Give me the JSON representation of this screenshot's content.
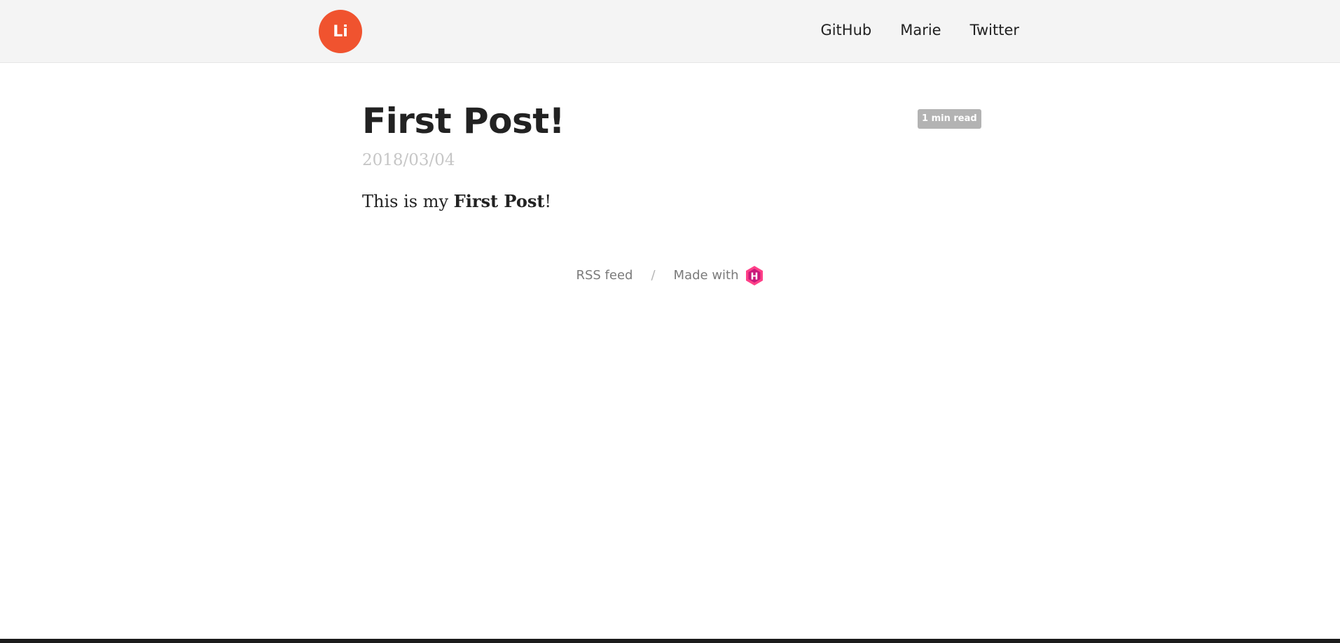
{
  "header": {
    "logo_text": "Li",
    "nav": [
      {
        "label": "GitHub"
      },
      {
        "label": "Marie"
      },
      {
        "label": "Twitter"
      }
    ]
  },
  "post": {
    "title": "First Post!",
    "read_time": "1 min read",
    "date": "2018/03/04",
    "body_prefix": "This is my ",
    "body_bold": "First Post",
    "body_suffix": "!"
  },
  "footer": {
    "rss_label": "RSS feed",
    "separator": "/",
    "made_with": "Made with",
    "hugo_icon": "hugo-icon",
    "hugo_color": "#ff4088"
  },
  "colors": {
    "logo_bg": "#f0532f",
    "topbar_bg": "#f4f4f4"
  }
}
